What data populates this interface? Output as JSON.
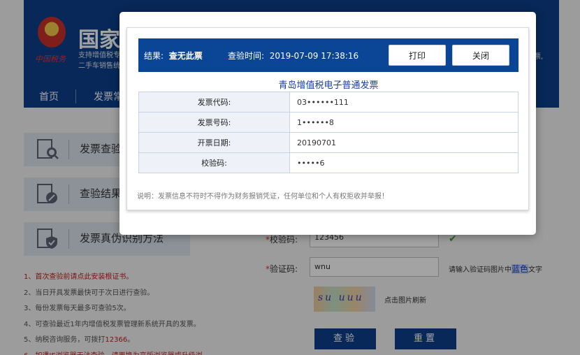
{
  "background": {
    "site_title": "国家",
    "logo_text": "中国税务",
    "subtitle_lines": [
      "支持增值税专",
      "二手车销售统"
    ],
    "right_fragment": "票,",
    "nav": [
      "首页",
      "发票常"
    ],
    "side_menu": [
      {
        "label": "发票查验",
        "icon": "search-icon"
      },
      {
        "label": "查验结果",
        "icon": "edit-icon"
      },
      {
        "label": "发票真伪识别方法",
        "icon": "shield-icon"
      }
    ],
    "notes": [
      {
        "text": "1、首次查验前请点此安装根证书。",
        "red": true
      },
      {
        "text": "2、当日开具发票最快可于次日进行查验。",
        "red": false
      },
      {
        "text": "3、每份发票每天最多可查验5次。",
        "red": false
      },
      {
        "text": "4、可查验最近1年内增值税发票管理新系统开具的发票。",
        "red": false
      },
      {
        "prefix": "5、纳税咨询服务，可拨打",
        "highlight": "12366",
        "suffix": "。",
        "red": false
      },
      {
        "text": "6、如遇IE浏览器无法查验，请更换为高版浏览器或升级浏",
        "red": true
      }
    ],
    "form": {
      "check_code_label": "校验码:",
      "check_code_value": "123456",
      "captcha_label": "验证码:",
      "captcha_value": "wnu",
      "captcha_image_text": "su uuu",
      "hint_prefix": "请输入验证码图片中",
      "hint_color_word": "蓝色",
      "hint_suffix": "文字",
      "refresh_text": "点击图片刷新",
      "submit_label": "查验",
      "reset_label": "重置"
    }
  },
  "dialog": {
    "result_label": "结果:",
    "result_value": "查无此票",
    "time_label": "查验时间:",
    "time_value": "2019-07-09 17:38:16",
    "print_label": "打印",
    "close_label": "关闭",
    "invoice_title": "青岛增值税电子普通发票",
    "rows": [
      {
        "key": "发票代码:",
        "value": "03••••••111"
      },
      {
        "key": "发票号码:",
        "value": "1••••••8"
      },
      {
        "key": "开票日期:",
        "value": "20190701"
      },
      {
        "key": "校验码:",
        "value": "•••••6"
      }
    ],
    "note": "说明：发票信息不符时不得作为财务报销凭证，任何单位和个人有权拒收并举报！"
  },
  "colors": {
    "brand_blue": "#0b3f8a",
    "result_bar": "#0b4596",
    "title_blue": "#1d3f9a",
    "warning_red": "#c01f1f"
  }
}
